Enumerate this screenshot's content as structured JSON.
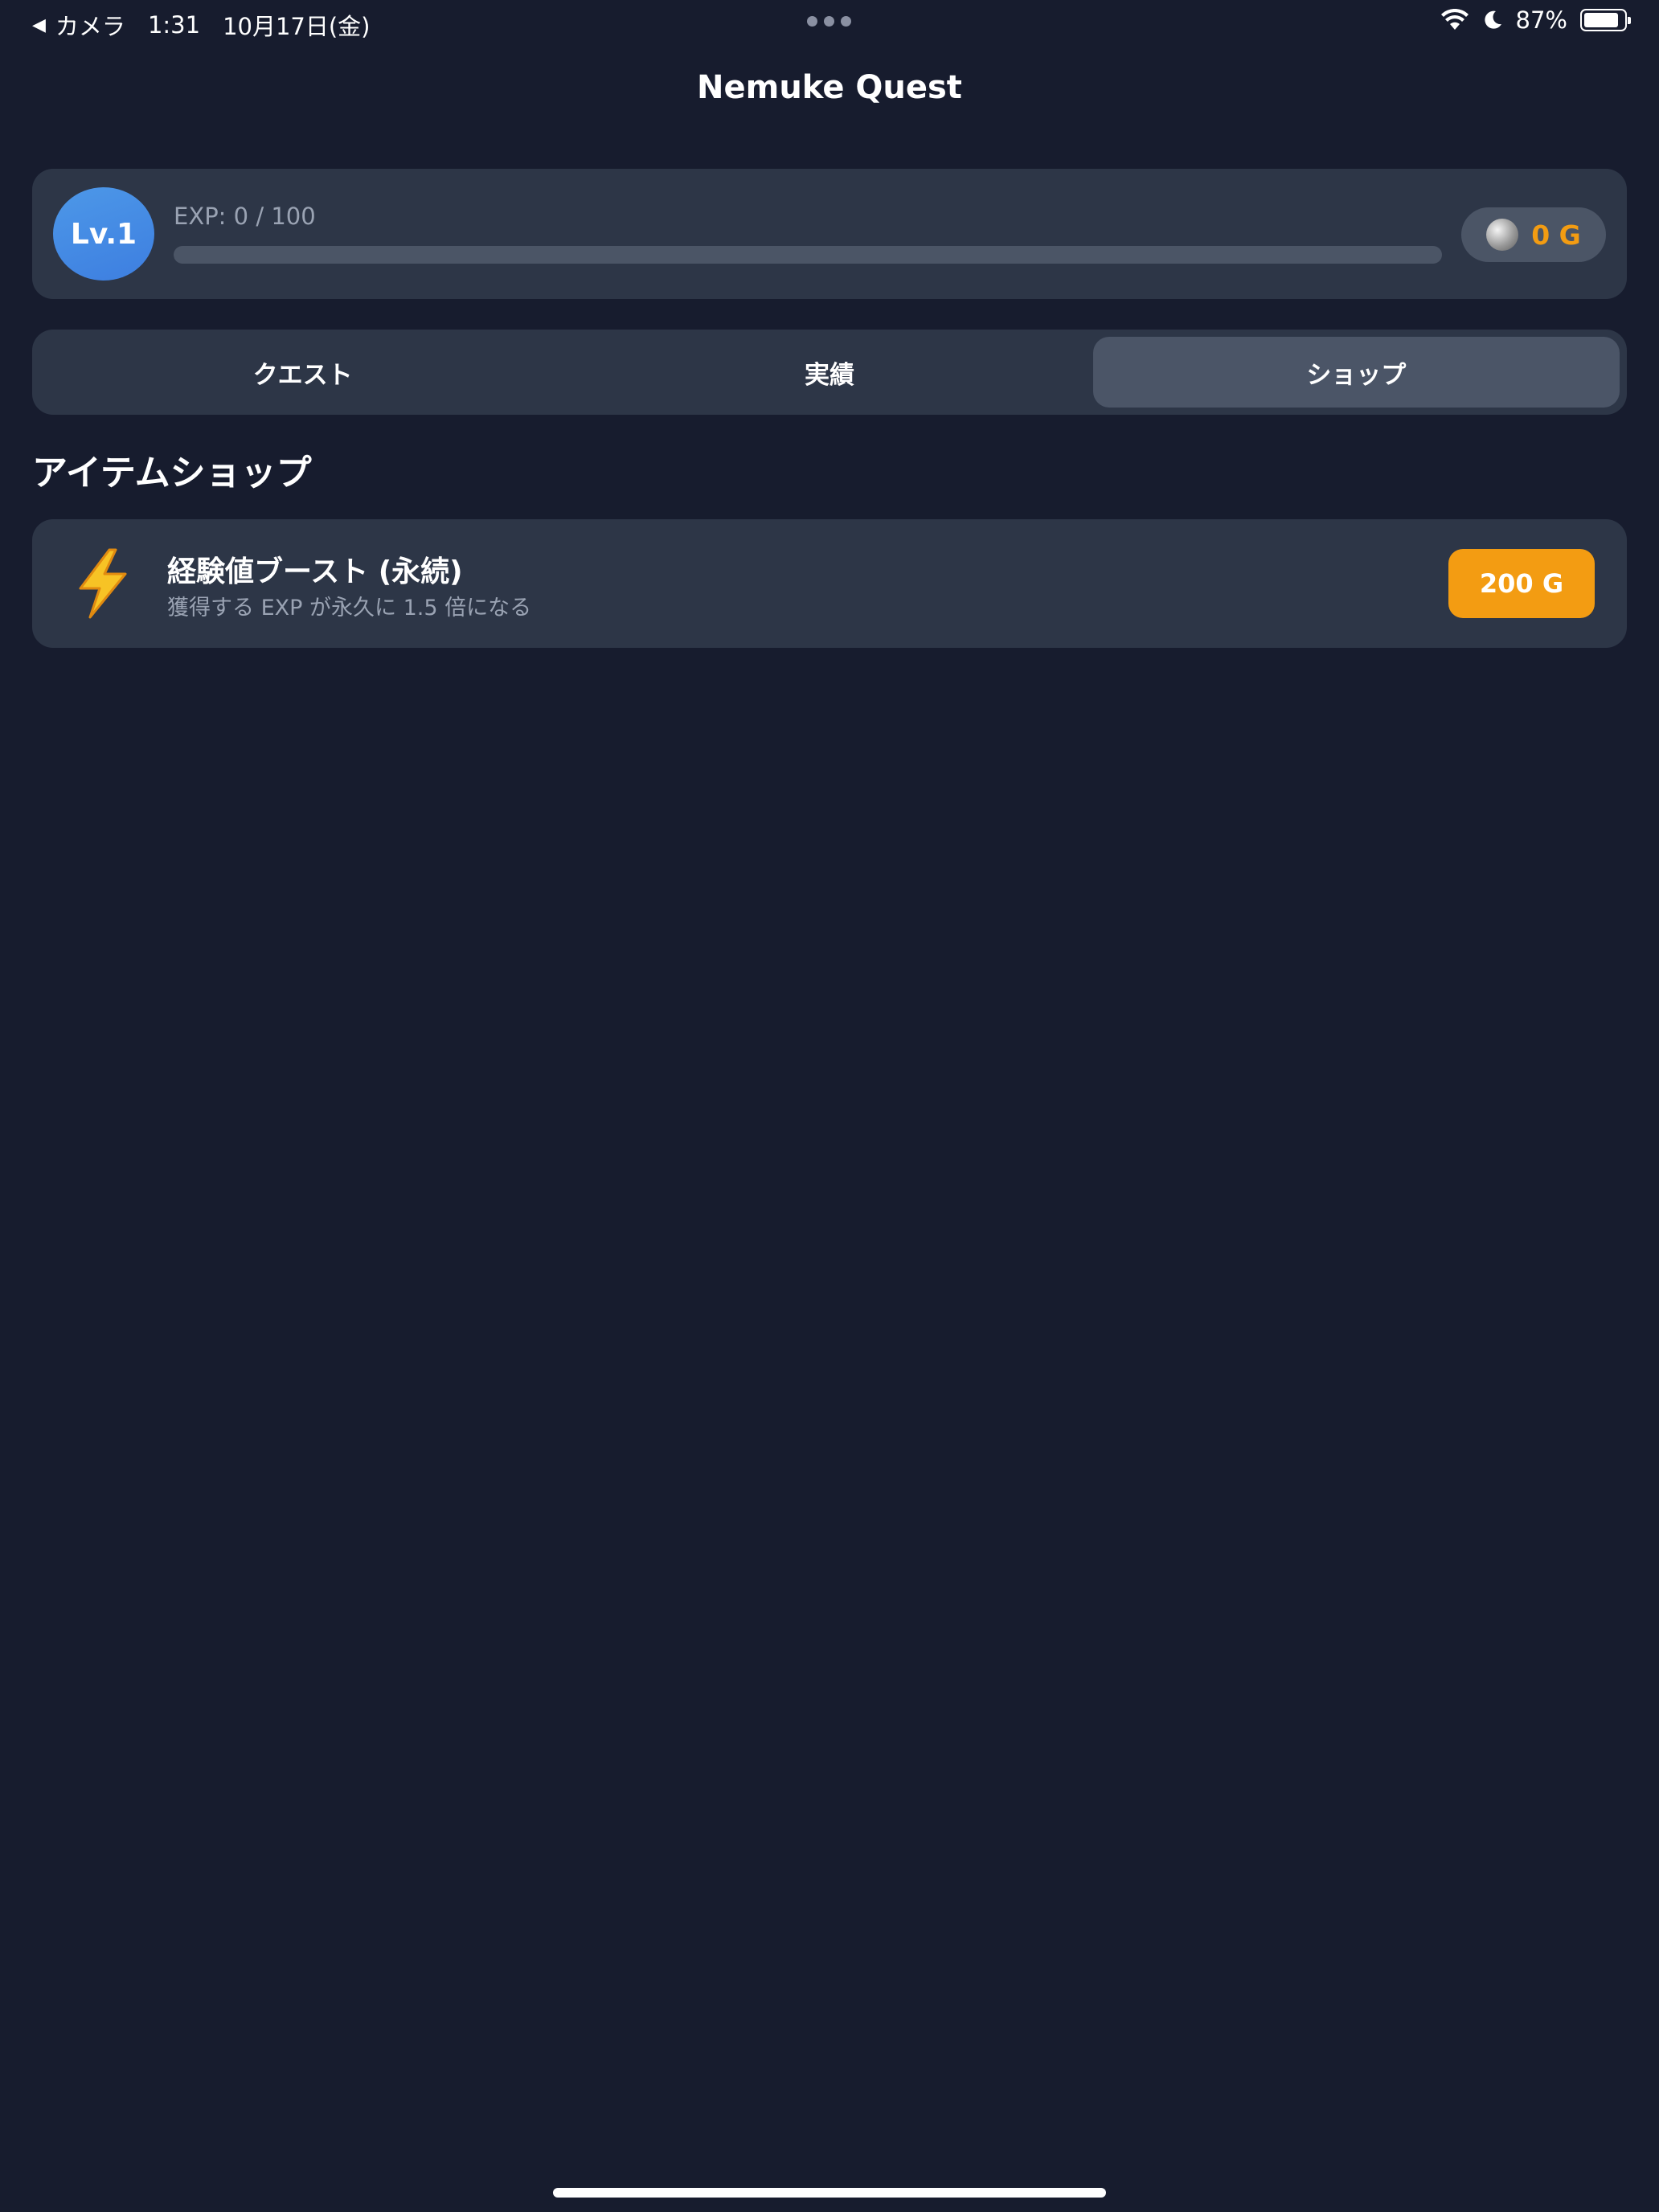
{
  "status_bar": {
    "back_label": "カメラ",
    "time": "1:31",
    "date": "10月17日(金)",
    "battery_percent": "87%",
    "battery_level": 0.87
  },
  "app": {
    "title": "Nemuke Quest"
  },
  "player": {
    "level_label": "Lv.1",
    "exp_label": "EXP: 0 / 100",
    "exp_progress": 0,
    "gold": "0 G"
  },
  "tabs": [
    {
      "label": "クエスト",
      "active": false
    },
    {
      "label": "実績",
      "active": false
    },
    {
      "label": "ショップ",
      "active": true
    }
  ],
  "shop": {
    "title": "アイテムショップ",
    "items": [
      {
        "icon": "lightning-icon",
        "name": "経験値ブースト (永続)",
        "description": "獲得する EXP が永久に 1.5 倍になる",
        "price": "200 G"
      }
    ]
  },
  "colors": {
    "background": "#171c2e",
    "card": "#2d3647",
    "accent_gold": "#f39c12",
    "level_blue": "#4d98e8"
  }
}
